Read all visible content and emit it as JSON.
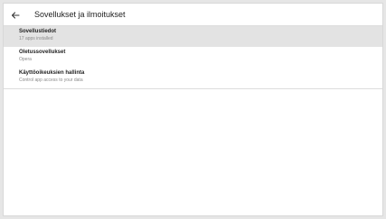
{
  "header": {
    "title": "Sovellukset ja ilmoitukset",
    "back_icon": "arrow-left-icon"
  },
  "items": [
    {
      "label": "Sovellustiedot",
      "sub": "17 apps installed",
      "selected": true
    },
    {
      "label": "Oletussovellukset",
      "sub": "Opera",
      "selected": false
    },
    {
      "label": "Käyttöoikeuksien hallinta",
      "sub": "Control app access to your data",
      "selected": false
    }
  ]
}
